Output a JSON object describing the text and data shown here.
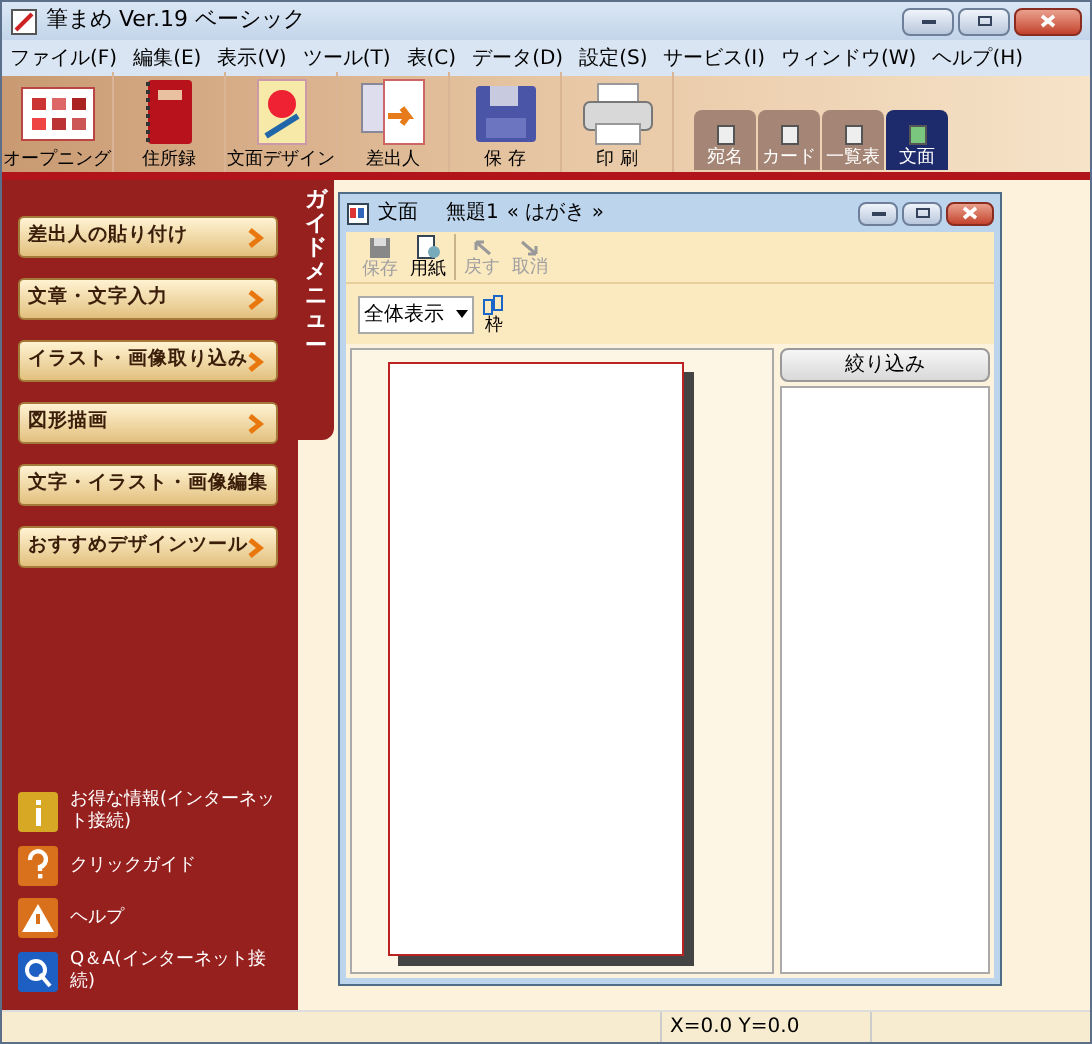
{
  "window": {
    "title": "筆まめ Ver.19 ベーシック"
  },
  "menu": [
    "ファイル(F)",
    "編集(E)",
    "表示(V)",
    "ツール(T)",
    "表(C)",
    "データ(D)",
    "設定(S)",
    "サービス(I)",
    "ウィンドウ(W)",
    "ヘルプ(H)"
  ],
  "toolbar": [
    {
      "kind": "opening",
      "label": "オープニング"
    },
    {
      "kind": "book",
      "label": "住所録"
    },
    {
      "kind": "design",
      "label": "文面デザイン"
    },
    {
      "kind": "sender",
      "label": "差出人"
    },
    {
      "kind": "disk",
      "label": "保 存"
    },
    {
      "kind": "printer",
      "label": "印 刷"
    }
  ],
  "view_tabs": [
    {
      "label": "宛名",
      "selected": false
    },
    {
      "label": "カード",
      "selected": false
    },
    {
      "label": "一覧表",
      "selected": false
    },
    {
      "label": "文面",
      "selected": true
    }
  ],
  "guide_tab": "ガイドメニュー",
  "guide_buttons": [
    "差出人の貼り付け",
    "文章・文字入力",
    "イラスト・画像取り込み",
    "図形描画",
    "文字・イラスト・画像編集",
    "おすすめデザインツール"
  ],
  "links": [
    {
      "kind": "info",
      "label": "お得な情報(インターネット接続)"
    },
    {
      "kind": "click",
      "label": "クリックガイド"
    },
    {
      "kind": "help",
      "label": "ヘルプ"
    },
    {
      "kind": "qa",
      "label": "Q＆A(インターネット接続)"
    }
  ],
  "document_window": {
    "title": "文面",
    "document": "無題1",
    "paper": "« はがき »",
    "tools": [
      {
        "kind": "save",
        "label": "保存",
        "disabled": true
      },
      {
        "kind": "paper",
        "label": "用紙",
        "disabled": false
      },
      {
        "kind": "undo",
        "label": "戻す",
        "disabled": true
      },
      {
        "kind": "redo",
        "label": "取消",
        "disabled": true
      }
    ],
    "zoom_select": "全体表示",
    "frame_button": "枠",
    "filter_button": "絞り込み"
  },
  "status_bar": {
    "coordinates": "X=0.0 Y=0.0"
  }
}
